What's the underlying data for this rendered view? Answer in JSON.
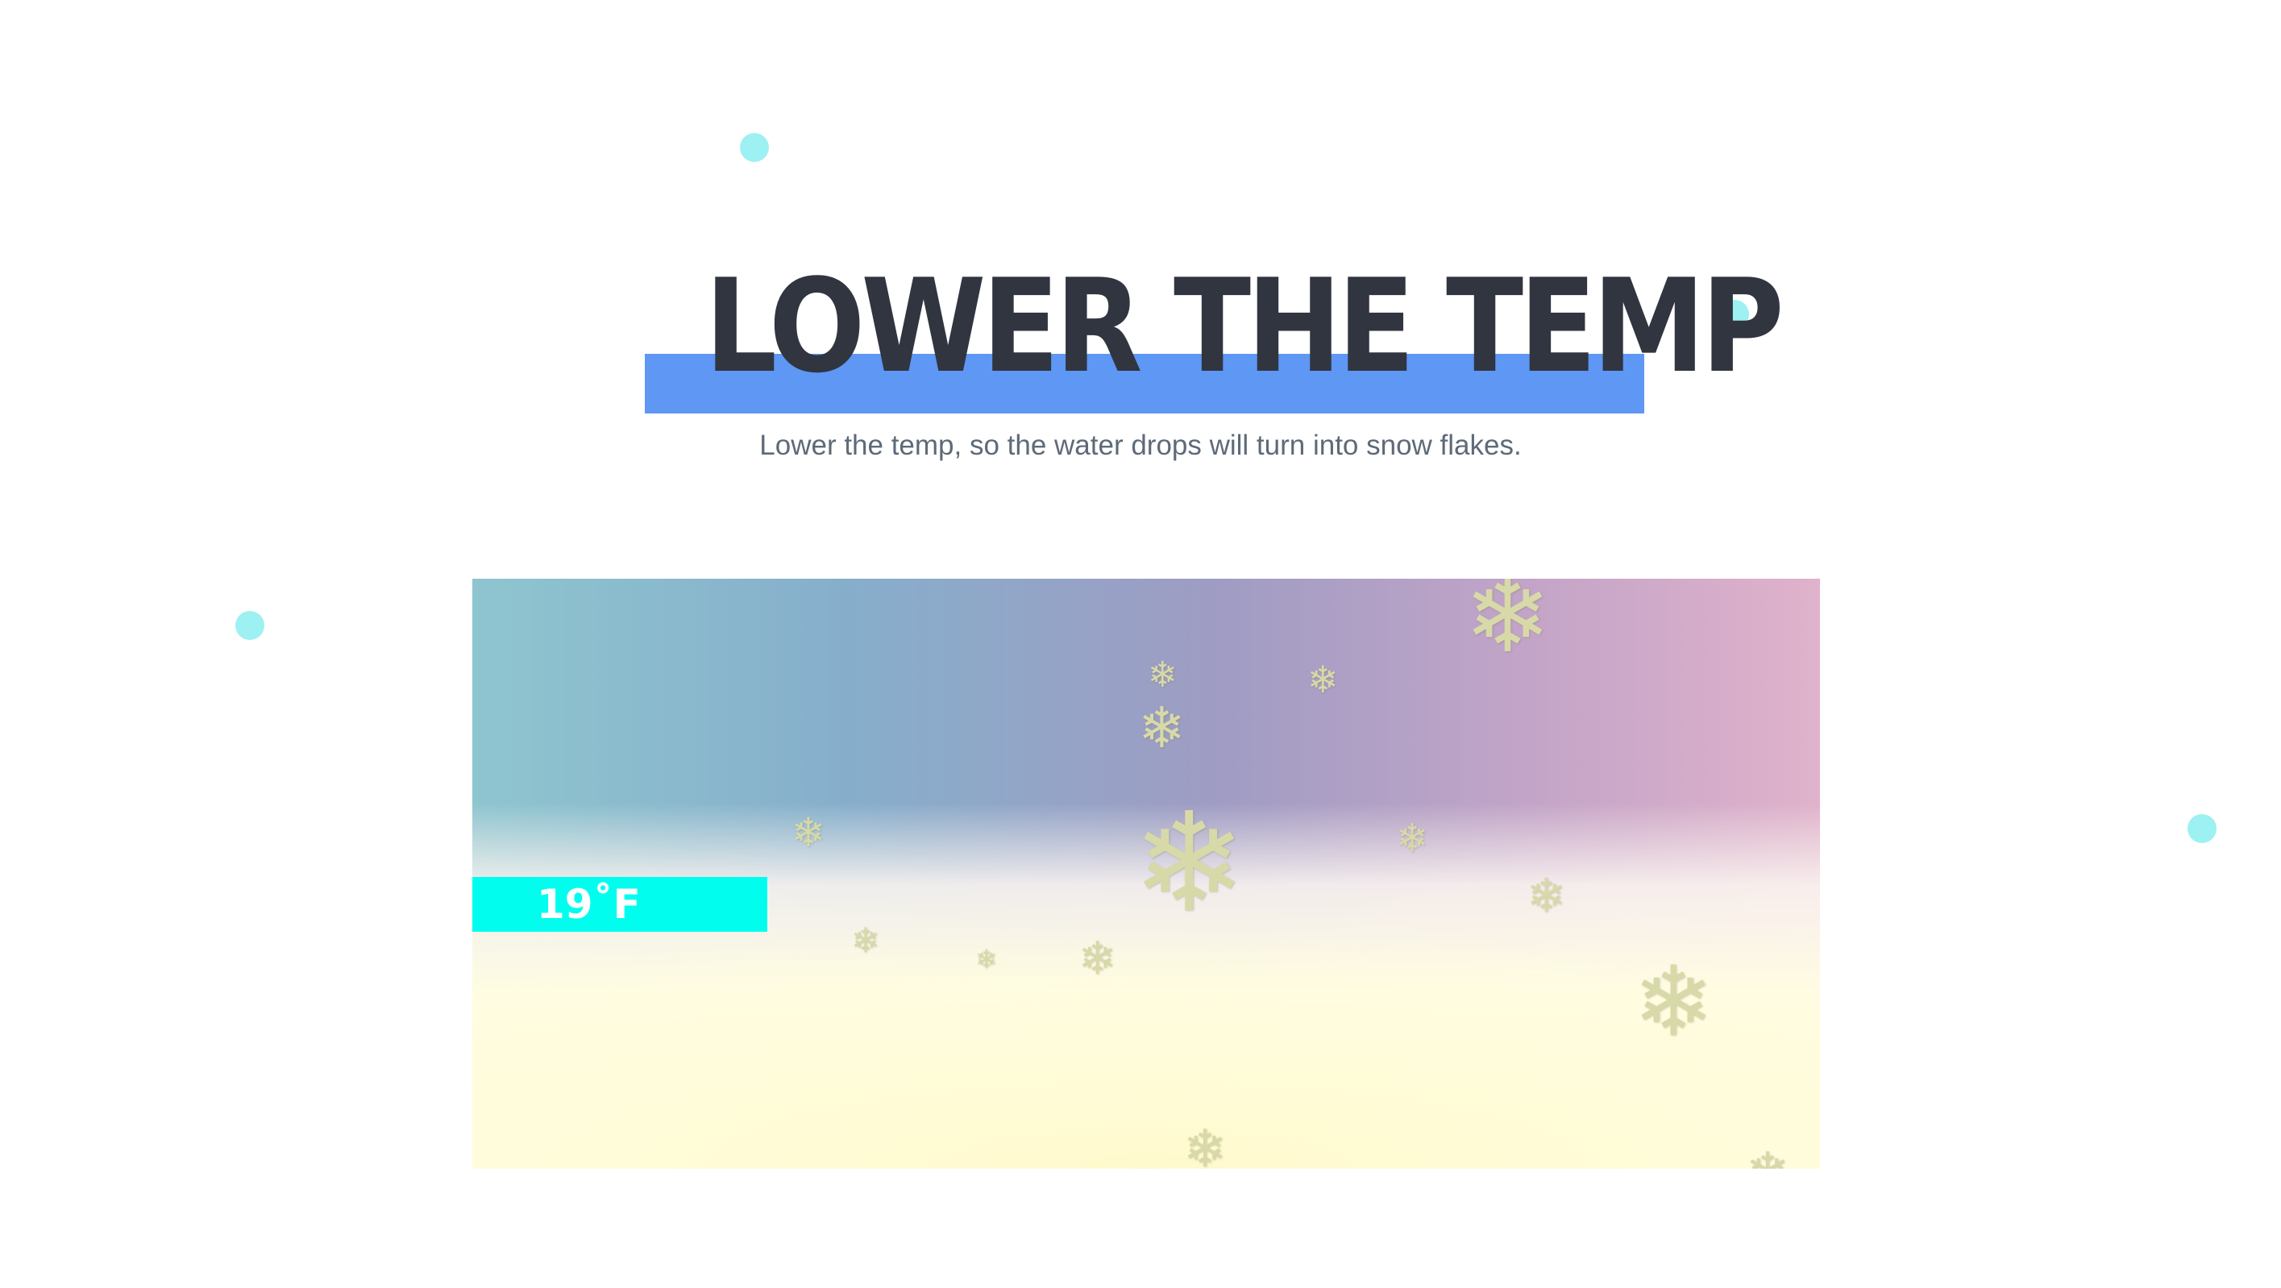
{
  "header": {
    "title": "LOWER THE TEMP",
    "subtitle": "Lower the temp, so the water drops will turn into snow flakes."
  },
  "scene": {
    "temperature": "19˚F",
    "flake_glyph": "❄"
  },
  "colors": {
    "title_text": "#303540",
    "title_highlight": "#5e97f4",
    "subtitle_text": "#5e6a78",
    "dots": "#9df1f2",
    "temp_badge": "#00fdee"
  }
}
